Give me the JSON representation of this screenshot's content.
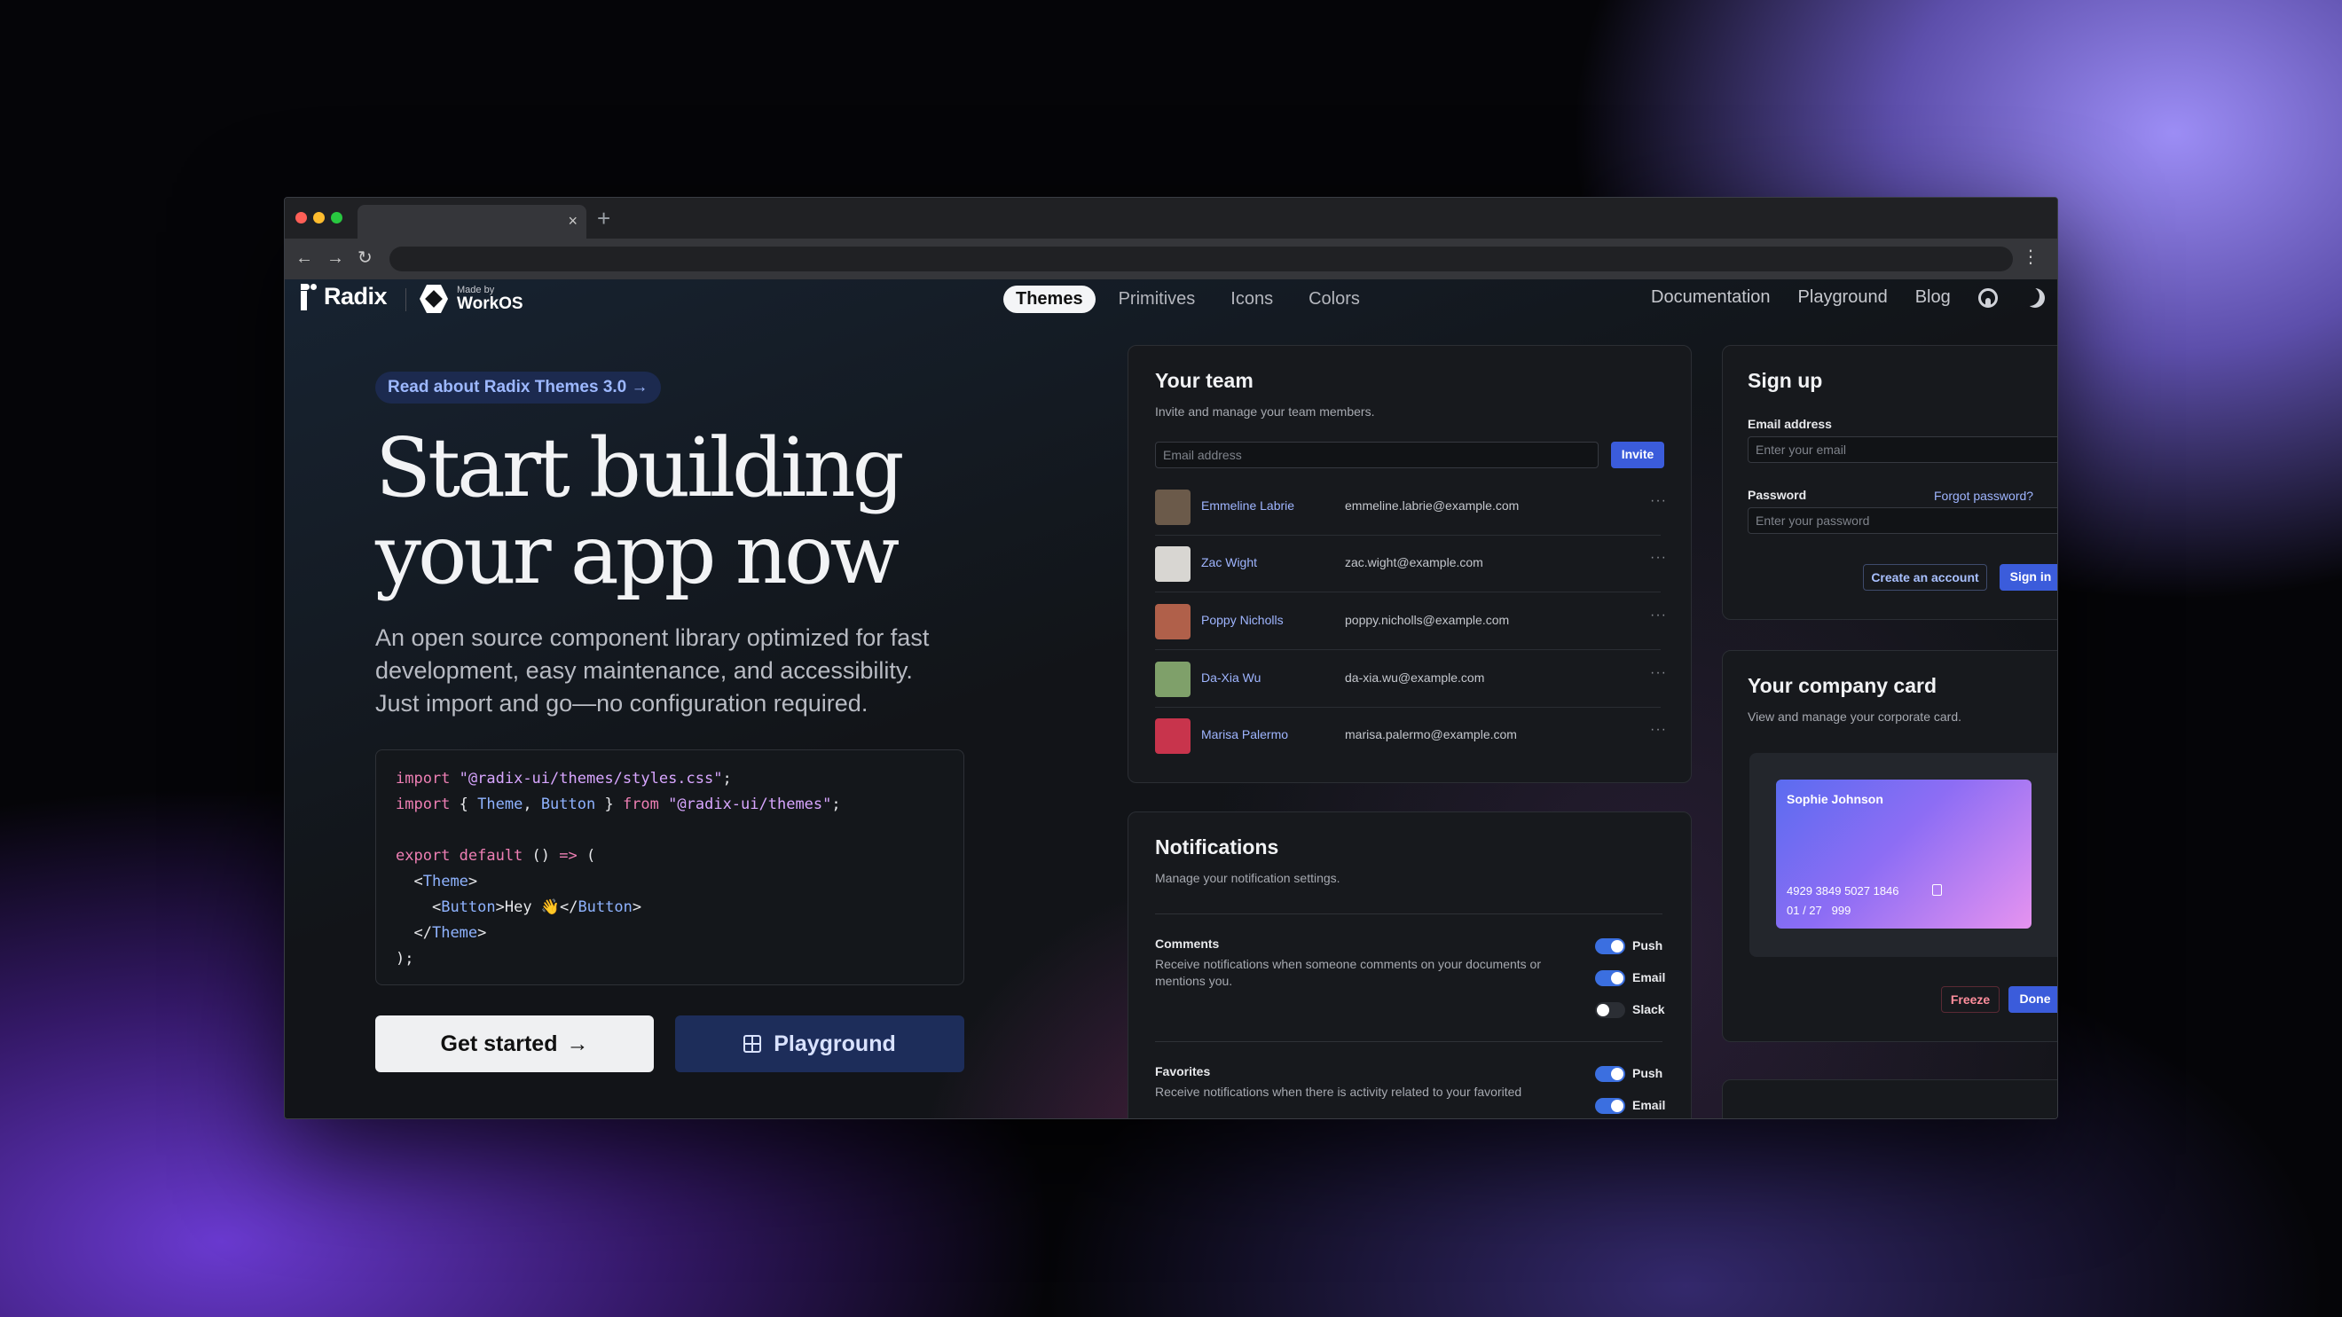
{
  "browser": {
    "tab_close": "×",
    "new_tab": "+",
    "back": "←",
    "forward": "→",
    "reload": "↻",
    "menu": "⋮"
  },
  "nav": {
    "brand": "Radix",
    "partner_small": "Made by",
    "partner_big": "WorkOS",
    "links": [
      "Themes",
      "Primitives",
      "Icons",
      "Colors"
    ],
    "right_links": [
      "Documentation",
      "Playground",
      "Blog"
    ]
  },
  "hero": {
    "announcement": "Read about Radix Themes 3.0 →",
    "title_line1": "Start building",
    "title_line2": "your app now",
    "subtitle": "An open source component library optimized for fast development, easy maintenance, and accessibility. Just import and go—no configuration required.",
    "code": {
      "l1_kw": "import",
      "l1_str": "\"@radix-ui/themes/styles.css\"",
      "l1_end": ";",
      "l2_kw": "import",
      "l2_mid": " { ",
      "l2_t1": "Theme",
      "l2_c": ", ",
      "l2_t2": "Button",
      "l2_close": " } ",
      "l2_from": "from",
      "l2_str": "\"@radix-ui/themes\"",
      "l2_end": ";",
      "l4_kw": "export default",
      "l4_rest": " () ",
      "l4_arrow": "=>",
      "l4_paren": " (",
      "l5_open": "<",
      "l5_tag": "Theme",
      "l5_close": ">",
      "l6_open": "<",
      "l6_tag": "Button",
      "l6_mid": ">Hey 👋</",
      "l6_tag2": "Button",
      "l6_close": ">",
      "l7_open": "</",
      "l7_tag": "Theme",
      "l7_close": ">",
      "l8": ");"
    },
    "get_started": "Get started",
    "playground": "Playground"
  },
  "team": {
    "title": "Your team",
    "subtitle": "Invite and manage your team members.",
    "email_placeholder": "Email address",
    "invite": "Invite",
    "members": [
      {
        "name": "Emmeline Labrie",
        "email": "emmeline.labrie@example.com",
        "color": "#6b5a4a"
      },
      {
        "name": "Zac Wight",
        "email": "zac.wight@example.com",
        "color": "#d8d6d2"
      },
      {
        "name": "Poppy Nicholls",
        "email": "poppy.nicholls@example.com",
        "color": "#b0604a"
      },
      {
        "name": "Da-Xia Wu",
        "email": "da-xia.wu@example.com",
        "color": "#7fa06a"
      },
      {
        "name": "Marisa Palermo",
        "email": "marisa.palermo@example.com",
        "color": "#c8344c"
      }
    ],
    "more": "···"
  },
  "notifications": {
    "title": "Notifications",
    "subtitle": "Manage your notification settings.",
    "comments_label": "Comments",
    "comments_desc": "Receive notifications when someone comments on your documents or mentions you.",
    "favorites_label": "Favorites",
    "favorites_desc": "Receive notifications when there is activity related to your favorited",
    "push": "Push",
    "email": "Email",
    "slack": "Slack"
  },
  "signup": {
    "title": "Sign up",
    "email_label": "Email address",
    "email_placeholder": "Enter your email",
    "password_label": "Password",
    "forgot": "Forgot password?",
    "password_placeholder": "Enter your password",
    "create": "Create an account",
    "signin": "Sign in"
  },
  "company_card": {
    "title": "Your company card",
    "subtitle": "View and manage your corporate card.",
    "holder": "Sophie Johnson",
    "number": "4929 3849 5027 1846",
    "expiry": "01 / 27",
    "cvc": "999",
    "freeze": "Freeze",
    "done": "Done"
  },
  "colors": {
    "accent": "#3b5cdb",
    "link": "#9fb5ff"
  }
}
